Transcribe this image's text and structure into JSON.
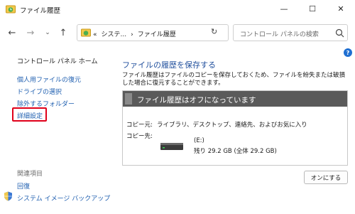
{
  "window": {
    "title": "ファイル履歴",
    "minimize_glyph": "—",
    "maximize_glyph": "☐",
    "close_glyph": "✕"
  },
  "nav": {
    "back_glyph": "←",
    "forward_glyph": "→",
    "recent_glyph": "⌄",
    "up_glyph": "↑",
    "refresh_glyph": "↻"
  },
  "address": {
    "prefix": "«",
    "segment1": "システ...",
    "separator": "›",
    "segment2": "ファイル履歴",
    "chevron": "⌄"
  },
  "search": {
    "placeholder": "コントロール パネルの検索"
  },
  "help": {
    "glyph": "?"
  },
  "sidebar": {
    "home": "コントロール パネル ホーム",
    "items": [
      {
        "label": "個人用ファイルの復元"
      },
      {
        "label": "ドライブの選択"
      },
      {
        "label": "除外するフォルダー"
      },
      {
        "label": "詳細設定"
      }
    ],
    "related_heading": "関連項目",
    "related": [
      {
        "label": "回復"
      },
      {
        "label": "システム イメージ バックアップ"
      }
    ]
  },
  "main": {
    "title": "ファイルの履歴を保存する",
    "description": "ファイル履歴はファイルのコピーを保存しておくため、ファイルを紛失または破損した場合に復元することができます。",
    "status": "ファイル履歴はオフになっています",
    "copy_from_label": "コピー元:",
    "copy_from_value": "ライブラリ、デスクトップ、連絡先、およびお気に入り",
    "copy_to_label": "コピー先:",
    "drive_name": "(E:)",
    "drive_space": "残り 29.2 GB (全体 29.2 GB)",
    "turn_on_button": "オンにする"
  },
  "colors": {
    "link": "#1f5fb0",
    "title": "#1f4e9c",
    "status_header": "#5a5a5a",
    "highlight_box": "#e0001a"
  }
}
